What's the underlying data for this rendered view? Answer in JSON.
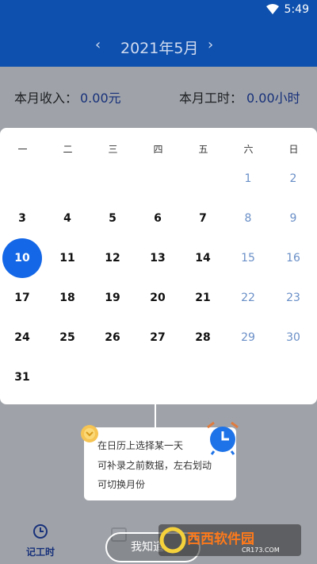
{
  "status": {
    "time": "5:49",
    "icons": [
      "wifi-icon"
    ]
  },
  "header": {
    "prev_icon": "‹",
    "title": "2021年5月",
    "next_icon": "›"
  },
  "summary": {
    "income_label": "本月收入：",
    "income_value": "0.00元",
    "hours_label": "本月工时：",
    "hours_value": "0.00小时"
  },
  "calendar": {
    "weekdays": [
      "一",
      "二",
      "三",
      "四",
      "五",
      "六",
      "日"
    ],
    "days": [
      "1",
      "2",
      "3",
      "4",
      "5",
      "6",
      "7",
      "8",
      "9",
      "10",
      "11",
      "12",
      "13",
      "14",
      "15",
      "16",
      "17",
      "18",
      "19",
      "20",
      "21",
      "22",
      "23",
      "24",
      "25",
      "26",
      "27",
      "28",
      "29",
      "30",
      "31"
    ],
    "first_weekday_index": 5,
    "selected_day": "10"
  },
  "tooltip": {
    "lines": [
      "在日历上选择某一天",
      "可补录之前数据，左右划动",
      "可切换月份"
    ],
    "icons": [
      "coin-icon",
      "alarm-clock-icon"
    ]
  },
  "bottom_nav": {
    "record_label": "记工时",
    "record_icon": "clock-refresh-icon"
  },
  "gotit_button": {
    "label": "我知道"
  },
  "watermark": {
    "text_main": "西西软件园",
    "text_sub": "CR173.COM"
  },
  "colors": {
    "accent": "#1467e6",
    "header_blue": "#0e50ad",
    "weekend_blue": "#6a8fc7",
    "overlay_gray": "#9fa3a9"
  }
}
